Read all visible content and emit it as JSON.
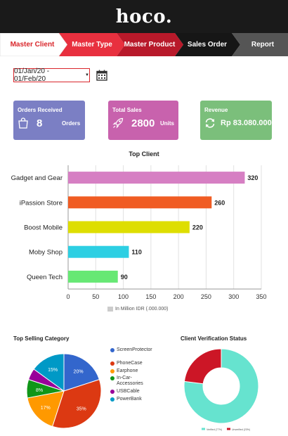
{
  "header": {
    "logo": "hoco."
  },
  "nav": {
    "steps": [
      {
        "label": "Master Client"
      },
      {
        "label": "Master Type"
      },
      {
        "label": "Master Product"
      },
      {
        "label": "Sales Order"
      },
      {
        "label": "Report"
      }
    ]
  },
  "filters": {
    "date_range": "01/Jan/20 - 01/Feb/20"
  },
  "cards": {
    "orders": {
      "title": "Orders Received",
      "value": "8",
      "unit": "Orders",
      "icon": "shopping-bag-icon",
      "color": "#7b7fc4"
    },
    "sales": {
      "title": "Total Sales",
      "value": "2800",
      "unit": "Units",
      "icon": "rocket-icon",
      "color": "#c862ad"
    },
    "revenue": {
      "title": "Revenue",
      "value": "Rp 83.080.000",
      "icon": "refresh-icon",
      "color": "#7bbf7b"
    }
  },
  "chart_data": [
    {
      "type": "bar",
      "orientation": "horizontal",
      "title": "Top Client",
      "categories": [
        "Gadget and Gear",
        "iPassion Store",
        "Boost Mobile",
        "Moby Shop",
        "Queen Tech"
      ],
      "values": [
        320,
        260,
        220,
        110,
        90
      ],
      "colors": [
        "#d67fc3",
        "#f05c23",
        "#dede00",
        "#2dcfe3",
        "#67e874"
      ],
      "xlim": [
        0,
        350
      ],
      "xticks": [
        0,
        50,
        100,
        150,
        200,
        250,
        300,
        350
      ],
      "legend": "In Million IDR (.000.000)",
      "legend_position": "bottom",
      "grid": true
    },
    {
      "type": "pie",
      "title": "Top Selling Category",
      "labels": [
        "ScreenProtector",
        "PhoneCase",
        "Earphone",
        "In-Car-Accessories",
        "USBCable",
        "PowerBank"
      ],
      "values": [
        20,
        35,
        17,
        8,
        5,
        15
      ],
      "colors": [
        "#3366cc",
        "#dc3912",
        "#ff9900",
        "#109618",
        "#990099",
        "#0099c6"
      ],
      "legend_position": "right"
    },
    {
      "type": "pie",
      "subtype": "donut",
      "title": "Client Verification Status",
      "labels": [
        "Verified (77%)",
        "Unverified (23%)"
      ],
      "values": [
        77,
        23
      ],
      "colors": [
        "#66e3cf",
        "#cc1626"
      ],
      "legend_position": "bottom"
    }
  ]
}
